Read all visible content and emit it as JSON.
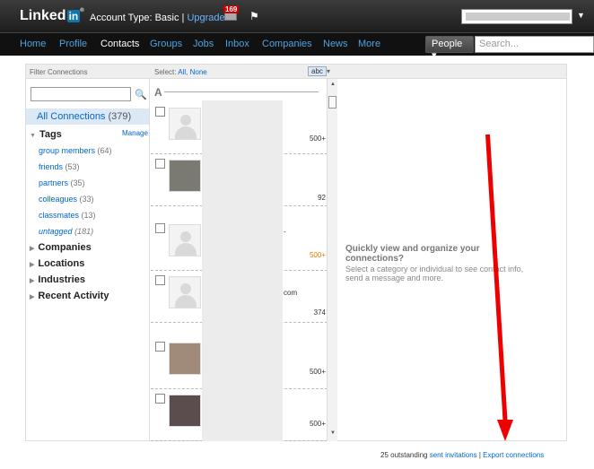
{
  "topbar": {
    "logo_text": "Linked",
    "logo_in": "in",
    "logo_reg": "®",
    "account_label": "Account Type: Basic | ",
    "upgrade": "Upgrade",
    "mail_badge": "169",
    "flag_icon": "⚑"
  },
  "nav": {
    "items": [
      "Home",
      "Profile",
      "Contacts",
      "Groups",
      "Jobs",
      "Inbox",
      "Companies",
      "News",
      "More"
    ],
    "people_button": "People ▾",
    "search_placeholder": "Search..."
  },
  "header": {
    "filter_connections": "Filter Connections",
    "select_label": "Select: ",
    "select_all": "All",
    "select_none": "None",
    "sort": "abc",
    "sort_caret": "▾"
  },
  "left": {
    "search_icon": "🔍",
    "all_connections": "All Connections",
    "all_count": "(379)",
    "tags_label": "Tags",
    "manage": "Manage",
    "tags": [
      {
        "name": "group members",
        "count": "(64)"
      },
      {
        "name": "friends",
        "count": "(53)"
      },
      {
        "name": "partners",
        "count": "(35)"
      },
      {
        "name": "colleagues",
        "count": "(33)"
      },
      {
        "name": "classmates",
        "count": "(13)"
      },
      {
        "name": "untagged",
        "count": "(181)"
      }
    ],
    "sections": [
      "Companies",
      "Locations",
      "Industries",
      "Recent Activity"
    ]
  },
  "middle": {
    "letter": "A",
    "counts": [
      "500+",
      "92",
      "500+",
      "374",
      "500+",
      "500+"
    ],
    "dash_text": "-",
    "com_text": "com"
  },
  "right": {
    "title": "Quickly view and organize your connections?",
    "desc": "Select a category or individual to see contact info, send a message and more."
  },
  "footer": {
    "outstanding": "25 outstanding ",
    "sent_invitations": "sent invitations",
    "sep": " | ",
    "export": "Export connections"
  },
  "colors": {
    "accent": "#0e76a8",
    "link": "#0066cc",
    "annotation_arrow": "#e00000"
  }
}
